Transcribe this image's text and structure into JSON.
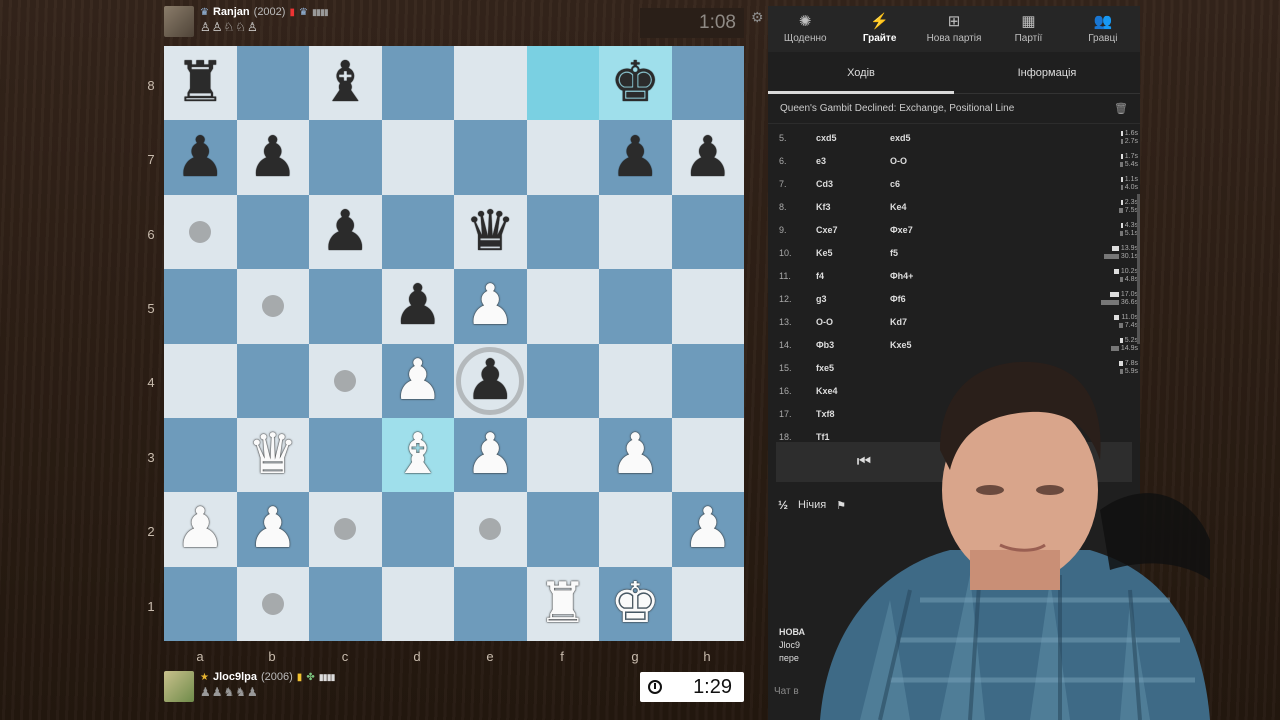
{
  "top_player": {
    "name": "Ranjan",
    "rating": "(2002)",
    "captured": "♙♙♘♘♙"
  },
  "bottom_player": {
    "name": "Jloc9lpa",
    "rating": "(2006)",
    "captured": "♟♟♞♞♟"
  },
  "clocks": {
    "top": "1:08",
    "bottom": "1:29"
  },
  "board": {
    "ranks": [
      "8",
      "7",
      "6",
      "5",
      "4",
      "3",
      "2",
      "1"
    ],
    "files": [
      "a",
      "b",
      "c",
      "d",
      "e",
      "f",
      "g",
      "h"
    ]
  },
  "nav": [
    {
      "label": "Щоденно",
      "icon": "sun-icon"
    },
    {
      "label": "Грайте",
      "icon": "bolt-icon"
    },
    {
      "label": "Нова партія",
      "icon": "plus-icon"
    },
    {
      "label": "Партії",
      "icon": "board-icon"
    },
    {
      "label": "Гравці",
      "icon": "users-icon"
    }
  ],
  "tabs": {
    "moves": "Ходів",
    "info": "Інформація"
  },
  "opening": "Queen's Gambit Declined: Exchange, Positional Line",
  "moves": [
    {
      "n": "5.",
      "w": "cxd5",
      "b": "exd5",
      "tw": "1.6s",
      "tb": "2.7s"
    },
    {
      "n": "6.",
      "w": "e3",
      "b": "O-O",
      "tw": "1.7s",
      "tb": "5.4s"
    },
    {
      "n": "7.",
      "w": "Cd3",
      "b": "c6",
      "tw": "1.1s",
      "tb": "4.0s"
    },
    {
      "n": "8.",
      "w": "Kf3",
      "b": "Ke4",
      "tw": "2.3s",
      "tb": "7.5s"
    },
    {
      "n": "9.",
      "w": "Cxe7",
      "b": "Фxe7",
      "tw": "4.3s",
      "tb": "5.1s"
    },
    {
      "n": "10.",
      "w": "Ke5",
      "b": "f5",
      "tw": "13.9s",
      "tb": "30.1s"
    },
    {
      "n": "11.",
      "w": "f4",
      "b": "Фh4+",
      "tw": "10.2s",
      "tb": "4.8s"
    },
    {
      "n": "12.",
      "w": "g3",
      "b": "Фf6",
      "tw": "17.0s",
      "tb": "36.6s"
    },
    {
      "n": "13.",
      "w": "O-O",
      "b": "Kd7",
      "tw": "11.0s",
      "tb": "7.4s"
    },
    {
      "n": "14.",
      "w": "Фb3",
      "b": "Kxe5",
      "tw": "5.2s",
      "tb": "14.9s"
    },
    {
      "n": "15.",
      "w": "fxe5",
      "b": "",
      "tw": "7.8s",
      "tb": "5.9s"
    },
    {
      "n": "16.",
      "w": "Kxe4",
      "b": "",
      "tw": "",
      "tb": ""
    },
    {
      "n": "17.",
      "w": "Txf8",
      "b": "",
      "tw": "",
      "tb": ""
    },
    {
      "n": "18.",
      "w": "Tf1",
      "b": "",
      "tw": "",
      "tb": ""
    }
  ],
  "controls": {
    "first": "⏮",
    "last": "⏭"
  },
  "draw_label": "Нічия",
  "draw_symbol": "½",
  "notification": {
    "title": "НОВА",
    "line1": "Jloc9",
    "line2": "пере"
  },
  "chat_placeholder": "Чат в"
}
